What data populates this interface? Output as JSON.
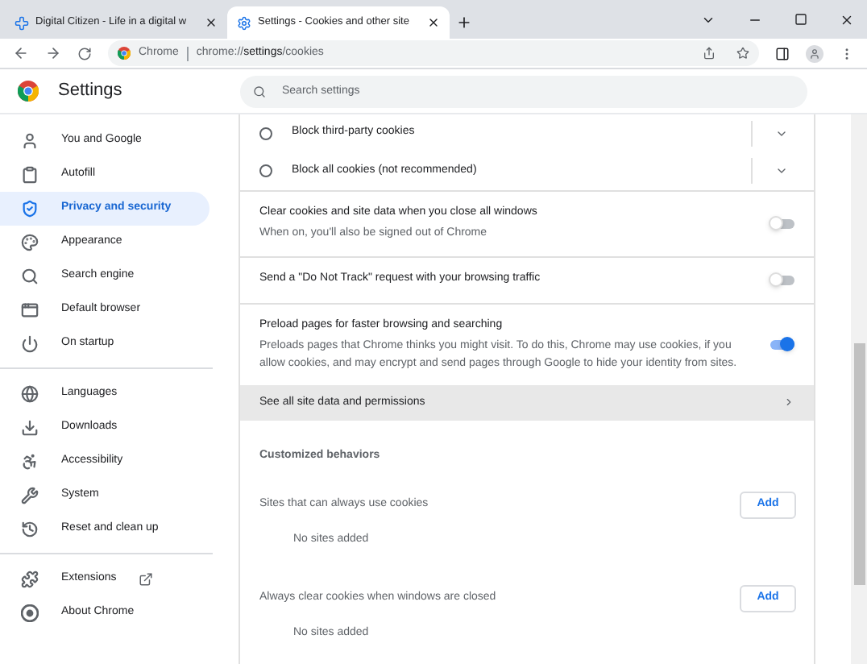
{
  "tabs": [
    {
      "title": "Digital Citizen - Life in a digital w",
      "selected": false
    },
    {
      "title": "Settings - Cookies and other site",
      "selected": true
    }
  ],
  "address": {
    "origin_label": "Chrome",
    "url_prefix": "chrome://",
    "url_bold": "settings",
    "url_suffix": "/cookies"
  },
  "header": {
    "title": "Settings",
    "search_placeholder": "Search settings"
  },
  "sidebar": {
    "groups": [
      [
        {
          "kind": "person",
          "label": "You and Google",
          "selected": false
        },
        {
          "kind": "clipboard",
          "label": "Autofill",
          "selected": false
        },
        {
          "kind": "shield",
          "label": "Privacy and security",
          "selected": true
        },
        {
          "kind": "palette",
          "label": "Appearance",
          "selected": false
        },
        {
          "kind": "search",
          "label": "Search engine",
          "selected": false
        },
        {
          "kind": "browser",
          "label": "Default browser",
          "selected": false
        },
        {
          "kind": "power",
          "label": "On startup",
          "selected": false
        }
      ],
      [
        {
          "kind": "globe",
          "label": "Languages",
          "selected": false
        },
        {
          "kind": "download",
          "label": "Downloads",
          "selected": false
        },
        {
          "kind": "accessibility",
          "label": "Accessibility",
          "selected": false
        },
        {
          "kind": "wrench",
          "label": "System",
          "selected": false
        },
        {
          "kind": "history",
          "label": "Reset and clean up",
          "selected": false
        }
      ],
      [
        {
          "kind": "puzzle",
          "label": "Extensions",
          "selected": false,
          "external": true
        },
        {
          "kind": "chrome",
          "label": "About Chrome",
          "selected": false
        }
      ]
    ]
  },
  "radio_options": [
    {
      "label": "Block third-party cookies",
      "selected": false
    },
    {
      "label": "Block all cookies (not recommended)",
      "selected": false
    }
  ],
  "toggles": [
    {
      "title": "Clear cookies and site data when you close all windows",
      "description": "When on, you'll also be signed out of Chrome",
      "on": false
    },
    {
      "title": "Send a \"Do Not Track\" request with your browsing traffic",
      "on": false
    },
    {
      "title": "Preload pages for faster browsing and searching",
      "description": "Preloads pages that Chrome thinks you might visit. To do this, Chrome may use cookies, if you allow cookies, and may encrypt and send pages through Google to hide your identity from sites.",
      "on": true
    }
  ],
  "link_row": {
    "label": "See all site data and permissions"
  },
  "customized": {
    "heading": "Customized behaviors",
    "sections": [
      {
        "title": "Sites that can always use cookies",
        "button": "Add",
        "empty": "No sites added"
      },
      {
        "title": "Always clear cookies when windows are closed",
        "button": "Add",
        "empty": "No sites added"
      }
    ]
  }
}
